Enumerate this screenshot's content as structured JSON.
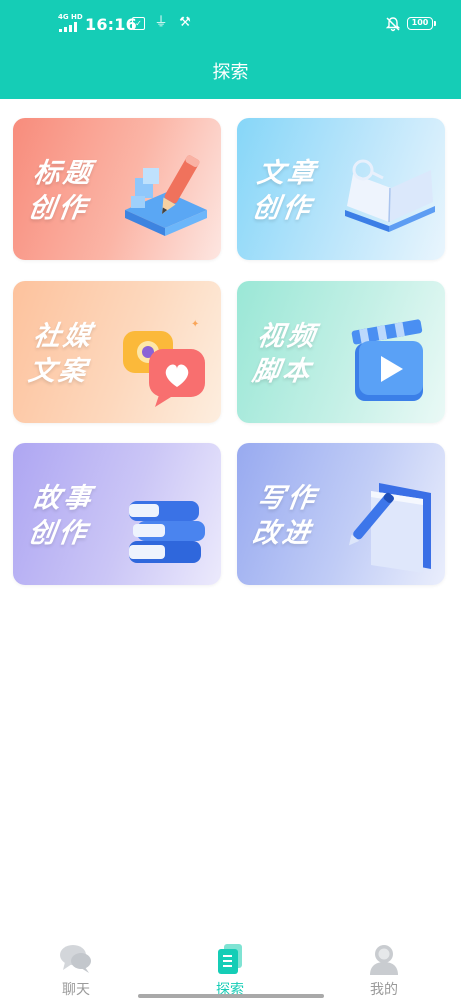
{
  "status_bar": {
    "network": "4G HD",
    "time": "16:16",
    "battery": "100",
    "icons": [
      "signal-icon",
      "data-saver-icon",
      "usb-icon",
      "developer-tools-icon",
      "mute-icon",
      "battery-icon"
    ]
  },
  "header": {
    "title": "探索"
  },
  "cards": [
    {
      "line1": "标题",
      "line2": "创作",
      "art": "pencil-blocks-icon",
      "color": "#f88c7c"
    },
    {
      "line1": "文章",
      "line2": "创作",
      "art": "open-book-icon",
      "color": "#86d6f8"
    },
    {
      "line1": "社媒",
      "line2": "文案",
      "art": "chat-heart-icon",
      "color": "#fdc29d"
    },
    {
      "line1": "视频",
      "line2": "脚本",
      "art": "video-play-icon",
      "color": "#9ae7d6"
    },
    {
      "line1": "故事",
      "line2": "创作",
      "art": "book-stack-icon",
      "color": "#aea6f2"
    },
    {
      "line1": "写作",
      "line2": "改进",
      "art": "pen-paper-icon",
      "color": "#98aaf0"
    }
  ],
  "tabbar": {
    "items": [
      {
        "label": "聊天",
        "icon": "chat-bubbles-icon",
        "active": false
      },
      {
        "label": "探索",
        "icon": "explore-doc-icon",
        "active": true
      },
      {
        "label": "我的",
        "icon": "profile-icon",
        "active": false
      }
    ],
    "accent": "#15cdb6",
    "inactive": "#9a9a9a"
  }
}
